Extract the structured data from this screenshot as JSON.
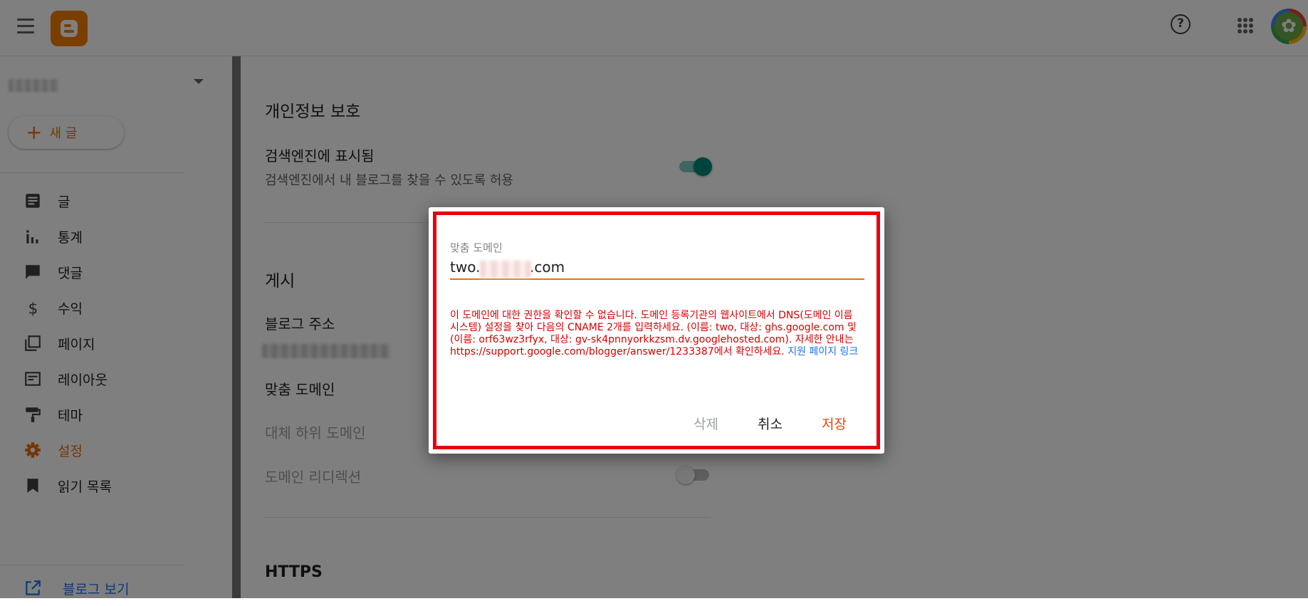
{
  "sidebar": {
    "new_post_label": "새 글",
    "items": [
      {
        "label": "글",
        "icon": "posts-icon"
      },
      {
        "label": "통계",
        "icon": "stats-icon"
      },
      {
        "label": "댓글",
        "icon": "comments-icon"
      },
      {
        "label": "수익",
        "icon": "earnings-icon"
      },
      {
        "label": "페이지",
        "icon": "pages-icon"
      },
      {
        "label": "레이아웃",
        "icon": "layout-icon"
      },
      {
        "label": "테마",
        "icon": "theme-icon"
      },
      {
        "label": "설정",
        "icon": "settings-icon",
        "active": true
      },
      {
        "label": "읽기 목록",
        "icon": "reading-list-icon"
      }
    ],
    "view_blog_label": "블로그 보기"
  },
  "main": {
    "privacy_heading": "개인정보 보호",
    "search_visible_title": "검색엔진에 표시됨",
    "search_visible_desc": "검색엔진에서 내 블로그를 찾을 수 있도록 허용",
    "publishing_heading": "게시",
    "blog_address_title": "블로그 주소",
    "custom_domain_title": "맞춤 도메인",
    "fallback_subdomain_title": "대체 하위 도메인",
    "domain_redirect_title": "도메인 리디렉션",
    "https_heading": "HTTPS"
  },
  "dialog": {
    "field_label": "맞춤 도메인",
    "value_prefix": "two.",
    "value_suffix": ".com",
    "error_text": "이 도메인에 대한 권한을 확인할 수 없습니다. 도메인 등록기관의 웹사이트에서 DNS(도메인 이름 시스템) 설정을 찾아 다음의 CNAME 2개를 입력하세요. (이름: two, 대상: ghs.google.com 및 (이름: orf63wz3rfyx, 대상: gv-sk4pnnyorkkzsm.dv.googlehosted.com). 자세한 안내는 https://support.google.com/blogger/answer/1233387에서 확인하세요.",
    "support_link": "지원 페이지 링크",
    "delete_label": "삭제",
    "cancel_label": "취소",
    "save_label": "저장"
  },
  "colors": {
    "accent": "#e8710a",
    "error": "#d50000",
    "toggle_on": "#00897b",
    "highlight_frame": "#e8000b"
  }
}
